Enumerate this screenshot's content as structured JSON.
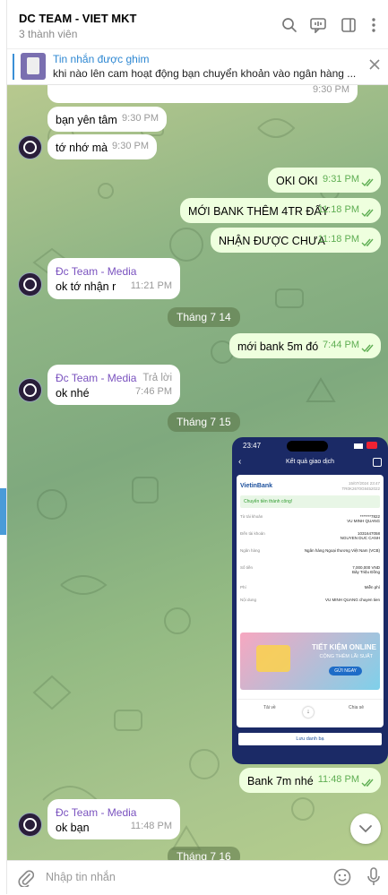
{
  "header": {
    "title": "DC TEAM - VIET MKT",
    "subtitle": "3 thành viên"
  },
  "pinned": {
    "title": "Tin nhắn được ghim",
    "text": "khi nào lên cam hoạt động bạn chuyển khoản vào ngân hàng ..."
  },
  "messages": [
    {
      "text": "bạn yên tâm",
      "time": "9:30 PM"
    },
    {
      "text": "tớ nhớ mà",
      "time": "9:30 PM"
    },
    {
      "text": "OKI OKI",
      "time": "9:31 PM"
    },
    {
      "text": "MỚI BANK THÊM 4TR ĐẤY",
      "time": "11:18 PM"
    },
    {
      "text": "NHẬN ĐƯỢC CHƯA",
      "time": "11:18 PM"
    },
    {
      "sender": "Đc Team - Media",
      "text": "ok tớ nhận r",
      "time": "11:21 PM"
    },
    {
      "text": "mới bank 5m đó",
      "time": "7:44 PM"
    },
    {
      "sender": "Đc Team - Media",
      "reply_label": "Trả lời",
      "text": "ok nhé",
      "time": "7:46 PM"
    },
    {
      "text": "Bank 7m nhé",
      "time": "11:48 PM"
    },
    {
      "sender": "Đc Team - Media",
      "text": "ok bạn",
      "time": "11:48 PM"
    }
  ],
  "partial_top_time": "9:30 PM",
  "dates": [
    "Tháng 7 14",
    "Tháng 7 15",
    "Tháng 7 16"
  ],
  "composer": {
    "placeholder": "Nhập tin nhắn"
  },
  "receipt": {
    "status_time": "23:47",
    "screen_title": "Kết quả giao dịch",
    "bank_name": "VietinBank",
    "datetime": "15/07/2024 23:47",
    "ref_code": "TR0K2670G8452022",
    "success": "Chuyển tiền thành công!",
    "rows": [
      {
        "label": "Từ tài khoản",
        "value": "*******7822\nVU MINH QUANG"
      },
      {
        "label": "Đến tài khoản",
        "value": "1031647058\nNGUYEN DUC CANH"
      },
      {
        "label": "Ngân hàng",
        "value": "Ngân hàng Ngoại thương Việt Nam (VCB)"
      },
      {
        "label": "Số tiền",
        "value": "7,000,000 VND\nBảy Triệu Đồng"
      },
      {
        "label": "Phí",
        "value": "Miễn phí"
      },
      {
        "label": "Nội dung",
        "value": "VU MINH QUANG chuyen tien"
      }
    ],
    "promo_title": "TIẾT KIỆM ONLINE",
    "promo_sub": "CỘNG THÊM LÃI SUẤT",
    "promo_btn": "GỬI NGAY",
    "save_label": "Tải về",
    "share_label": "Chia sẻ",
    "footer_btn": "Lưu danh bạ"
  },
  "colors": {
    "outgoing_bubble": "#eeffde",
    "incoming_bubble": "#ffffff",
    "sender_name": "#7a52bf",
    "accent": "#3a8fd6"
  }
}
